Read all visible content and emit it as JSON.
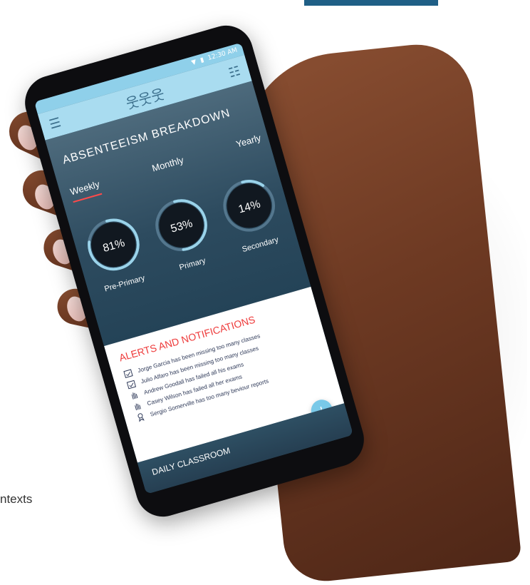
{
  "edge_text": "ntexts",
  "status": {
    "time": "12:30 AM"
  },
  "app": {
    "menu_icon": "menu-icon",
    "logo_icon": "people-logo-icon",
    "list_icon": "list-icon"
  },
  "absenteeism": {
    "title": "ABSENTEEISM BREAKDOWN",
    "tabs": [
      "Weekly",
      "Monthly",
      "Yearly"
    ],
    "active_tab": "Weekly",
    "rings": [
      {
        "label": "Pre-Primary",
        "value": "81%",
        "fraction": 0.81
      },
      {
        "label": "Primary",
        "value": "53%",
        "fraction": 0.53
      },
      {
        "label": "Secondary",
        "value": "14%",
        "fraction": 0.14
      }
    ]
  },
  "alerts": {
    "title": "ALERTS AND NOTIFICATIONS",
    "items": [
      {
        "text": "Jorge Garcia has been missing too many classes",
        "icon": "calendar-check-icon"
      },
      {
        "text": "Julio Alfaro has been missing too many classes",
        "icon": "calendar-check-icon"
      },
      {
        "text": "Andrew Goodall has failed all his exams",
        "icon": "hand-icon"
      },
      {
        "text": "Casey Wilson has failed all her exams",
        "icon": "hand-icon"
      },
      {
        "text": "Sergio Somerville has too many beviour reports",
        "icon": "award-icon"
      }
    ]
  },
  "daily": {
    "title": "DAILY CLASSROOM"
  },
  "fab": {
    "label": "+"
  },
  "colors": {
    "accent": "#8fd0ea",
    "alert_red": "#ee3b3b",
    "ring_track": "#7ba3bd",
    "ring_fill": "#9ad3ea"
  }
}
